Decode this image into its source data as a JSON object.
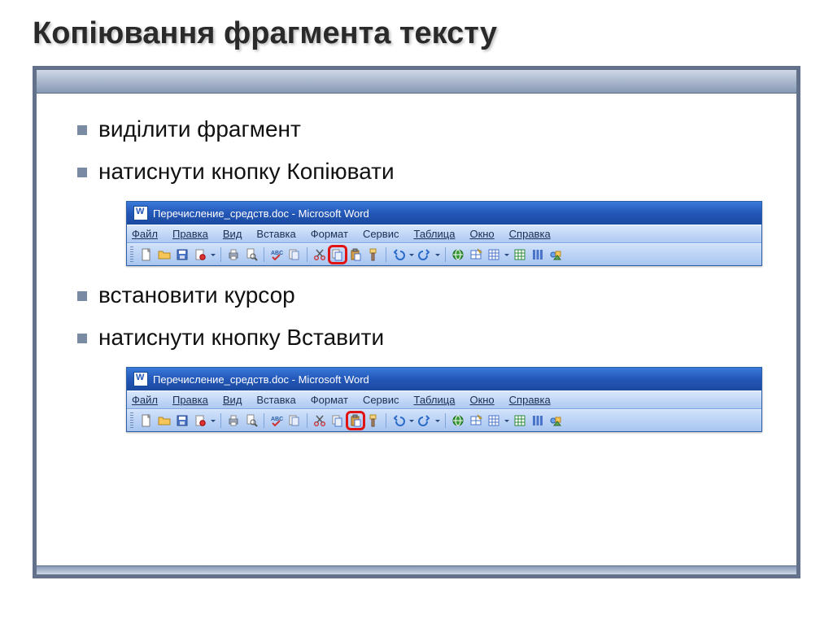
{
  "title": "Копіювання фрагмента тексту",
  "bullets": {
    "b1": "виділити фрагмент",
    "b2": "натиснути кнопку Копіювати",
    "b3": "встановити курсор",
    "b4": "натиснути кнопку Вставити"
  },
  "word": {
    "doc_title": "Перечисление_средств.doc - Microsoft Word",
    "menu": {
      "file": "Файл",
      "edit": "Правка",
      "view": "Вид",
      "insert": "Вставка",
      "format": "Формат",
      "service": "Сервис",
      "table": "Таблица",
      "window": "Окно",
      "help": "Справка"
    },
    "toolbar_icons": [
      "new-doc-icon",
      "open-icon",
      "save-icon",
      "permission-icon",
      "sep",
      "print-icon",
      "print-preview-icon",
      "sep",
      "spelling-icon",
      "research-icon",
      "sep",
      "cut-icon",
      "copy-icon",
      "paste-icon",
      "format-painter-icon",
      "sep",
      "undo-icon",
      "redo-icon",
      "sep",
      "hyperlink-icon",
      "tables-borders-icon",
      "insert-table-icon",
      "excel-icon",
      "columns-icon",
      "drawing-icon"
    ],
    "highlight_copy": "copy-icon",
    "highlight_paste": "paste-icon"
  }
}
